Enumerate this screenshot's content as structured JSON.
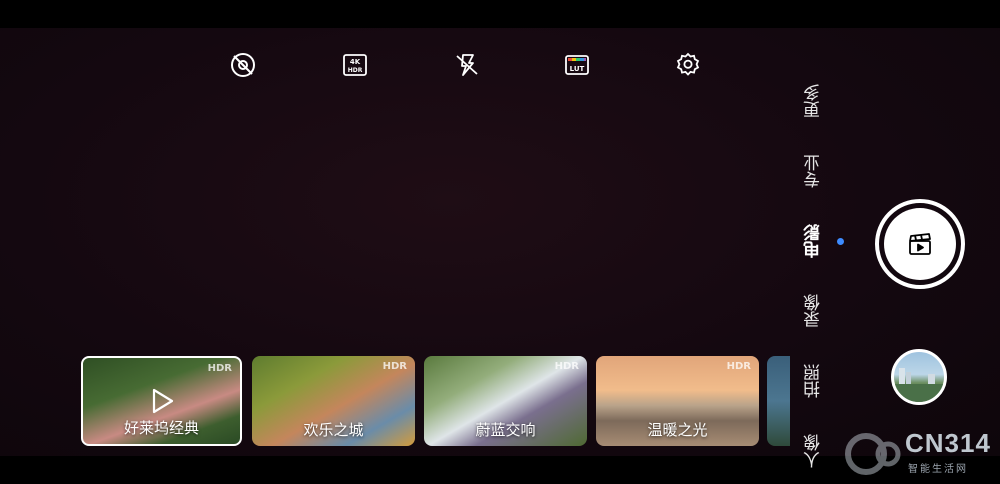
{
  "toolbar": {
    "items": [
      {
        "icon": "eye-off-icon"
      },
      {
        "icon": "4k-hdr-icon",
        "line1": "4K",
        "line2": "HDR"
      },
      {
        "icon": "flash-off-icon"
      },
      {
        "icon": "lut-icon",
        "label": "LUT"
      },
      {
        "icon": "gear-icon"
      }
    ]
  },
  "modes": [
    {
      "label": "更多",
      "active": false
    },
    {
      "label": "专业",
      "active": false
    },
    {
      "label": "电影",
      "active": true
    },
    {
      "label": "录像",
      "active": false
    },
    {
      "label": "拍照",
      "active": false
    },
    {
      "label": "人像",
      "active": false
    }
  ],
  "accent_color": "#3d8bff",
  "shutter": {
    "icon": "movie-clapper-icon"
  },
  "filters": [
    {
      "label": "好莱坞经典",
      "badge": "HDR",
      "selected": true
    },
    {
      "label": "欢乐之城",
      "badge": "HDR",
      "selected": false
    },
    {
      "label": "蔚蓝交响",
      "badge": "HDR",
      "selected": false
    },
    {
      "label": "温暖之光",
      "badge": "HDR",
      "selected": false
    }
  ],
  "watermark": {
    "text": "CN314",
    "subtitle": "智能生活网"
  }
}
